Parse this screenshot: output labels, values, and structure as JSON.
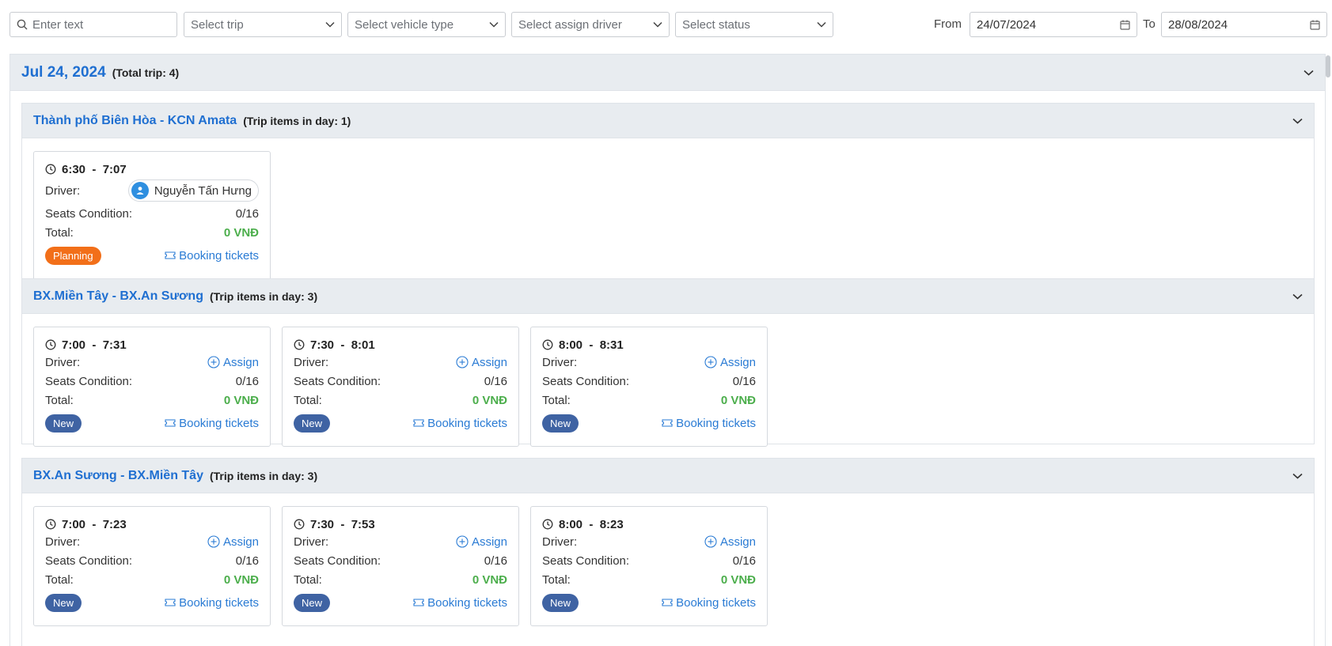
{
  "filters": {
    "search_placeholder": "Enter text",
    "trip_placeholder": "Select trip",
    "vehicle_placeholder": "Select vehicle type",
    "driver_placeholder": "Select assign driver",
    "status_placeholder": "Select status",
    "from_label": "From",
    "from_value": "24/07/2024",
    "to_label": "To",
    "to_value": "28/08/2024"
  },
  "day": {
    "title": "Jul 24, 2024",
    "count": "(Total trip: 4)"
  },
  "labels": {
    "driver": "Driver:",
    "seats": "Seats Condition:",
    "total": "Total:",
    "assign": "Assign",
    "booking": "Booking tickets",
    "sep": "-"
  },
  "routes": [
    {
      "title": "Thành phố Biên Hòa - KCN Amata",
      "count": "(Trip items in day: 1)",
      "trips": [
        {
          "start": "6:30",
          "end": "7:07",
          "driver": "Nguyễn Tấn Hưng",
          "seats": "0/16",
          "total": "0 VNĐ",
          "status": "Planning"
        }
      ]
    },
    {
      "title": "BX.Miền Tây - BX.An Sương",
      "count": "(Trip items in day: 3)",
      "trips": [
        {
          "start": "7:00",
          "end": "7:31",
          "seats": "0/16",
          "total": "0 VNĐ",
          "status": "New"
        },
        {
          "start": "7:30",
          "end": "8:01",
          "seats": "0/16",
          "total": "0 VNĐ",
          "status": "New"
        },
        {
          "start": "8:00",
          "end": "8:31",
          "seats": "0/16",
          "total": "0 VNĐ",
          "status": "New"
        }
      ]
    },
    {
      "title": "BX.An Sương - BX.Miền Tây",
      "count": "(Trip items in day: 3)",
      "trips": [
        {
          "start": "7:00",
          "end": "7:23",
          "seats": "0/16",
          "total": "0 VNĐ",
          "status": "New"
        },
        {
          "start": "7:30",
          "end": "7:53",
          "seats": "0/16",
          "total": "0 VNĐ",
          "status": "New"
        },
        {
          "start": "8:00",
          "end": "8:23",
          "seats": "0/16",
          "total": "0 VNĐ",
          "status": "New"
        }
      ]
    }
  ]
}
